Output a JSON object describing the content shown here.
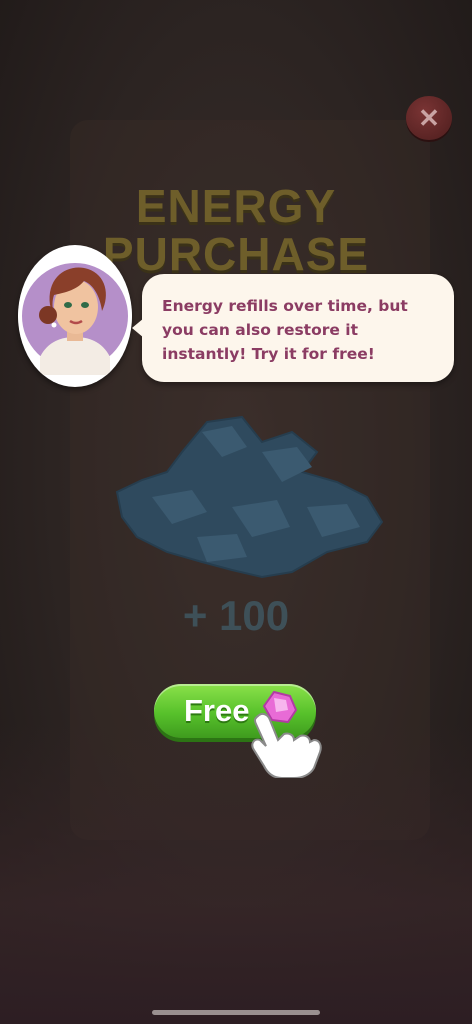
{
  "screen": {
    "title_line1": "ENERGY",
    "title_line2": "PURCHASE",
    "close_icon": "close-icon"
  },
  "reward": {
    "icon": "energy-bolt-pile-icon",
    "amount_label": "+ 100"
  },
  "free_button": {
    "label": "Free",
    "accent": "#57c12b",
    "gem_icon": "pink-gem-icon"
  },
  "tutorial": {
    "avatar": "assistant-avatar",
    "message": "Energy refills over time, but you can also restore it instantly! Try it for free!",
    "text_color": "#8b3c63",
    "pointer_icon": "pointing-hand-icon"
  }
}
